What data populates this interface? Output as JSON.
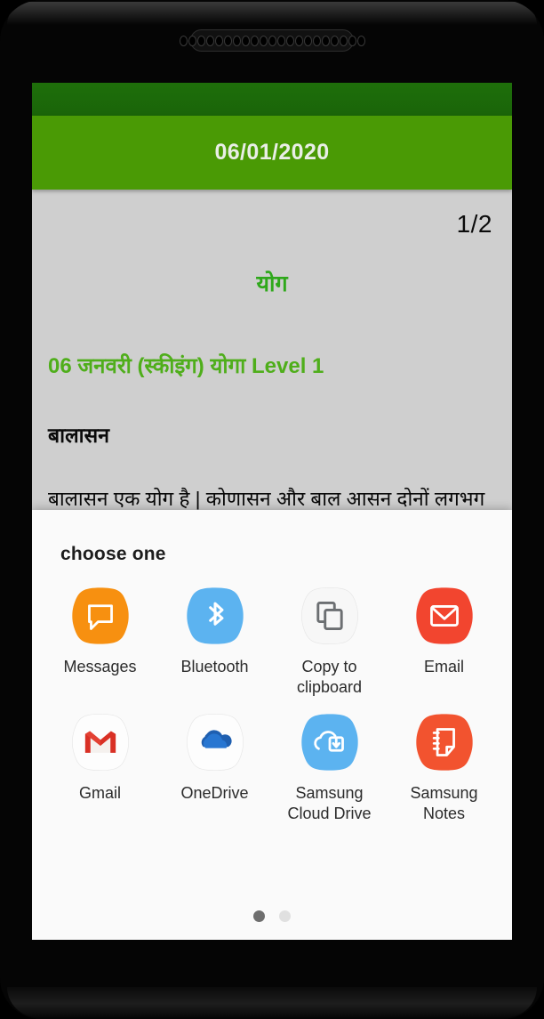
{
  "device": {
    "earpiece_hole_count": 21
  },
  "app": {
    "actionbar": {
      "title": "06/01/2020"
    },
    "page_counter": "1/2",
    "colors": {
      "statusbar": "#1a6409",
      "actionbar": "#4a9a05",
      "heading_green": "#2fa81b",
      "lesson_green": "#4fae1b",
      "content_bg": "#cfcfcf"
    },
    "content": {
      "heading": "योग",
      "lesson_title": "06 जनवरी (स्कीइंग) योगा Level 1",
      "asana_name": "बालासन",
      "body_text": "बालासन एक योग है | कोणासन और बाल आसन दोनों लगभग समान योग है | बालासन = बाल +"
    }
  },
  "share_sheet": {
    "title": "choose one",
    "apps": [
      {
        "label": "Messages",
        "icon": "messages-icon",
        "bg": "#f79010"
      },
      {
        "label": "Bluetooth",
        "icon": "bluetooth-icon",
        "bg": "#5cb3f0"
      },
      {
        "label": "Copy to clipboard",
        "icon": "copy-to-clipboard-icon",
        "bg": "#f7f7f7"
      },
      {
        "label": "Email",
        "icon": "email-icon",
        "bg": "#f2452f"
      },
      {
        "label": "Gmail",
        "icon": "gmail-icon",
        "bg": "#fdfdfd"
      },
      {
        "label": "OneDrive",
        "icon": "onedrive-icon",
        "bg": "#fdfdfd"
      },
      {
        "label": "Samsung Cloud Drive",
        "icon": "samsung-cloud-drive-icon",
        "bg": "#5cb3f0"
      },
      {
        "label": "Samsung Notes",
        "icon": "samsung-notes-icon",
        "bg": "#f2532f"
      }
    ],
    "pager": {
      "pages": 2,
      "active_page": 1
    }
  }
}
